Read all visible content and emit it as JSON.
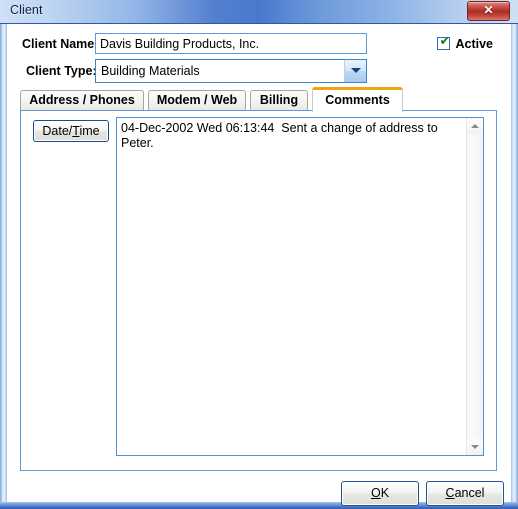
{
  "window": {
    "title": "Client",
    "close_label": "✕",
    "close_icon": "close-icon",
    "frame_color": "#3f6fc4",
    "titlebar_gradient_from": "#cfe0f5",
    "titlebar_gradient_to": "#4a78cd",
    "close_button_color": "#ab2c23"
  },
  "form": {
    "client_name": {
      "label": "Client Name:",
      "value": "Davis Building Products, Inc.",
      "placeholder": ""
    },
    "client_type": {
      "label": "Client Type:",
      "value": "Building Materials",
      "arrow_icon": "chevron-down-icon",
      "options": [
        "Building Materials"
      ]
    },
    "active": {
      "label": "Active",
      "checked": true,
      "check_glyph": "✔",
      "check_color": "#137d22"
    }
  },
  "tabs": {
    "selected_index": 3,
    "selected_color": "#f0a313",
    "items": [
      {
        "label": "Address / Phones"
      },
      {
        "label": "Modem / Web"
      },
      {
        "label": "Billing"
      },
      {
        "label": "Comments"
      }
    ]
  },
  "comments_page": {
    "datetime_button": {
      "label_before": "Date/",
      "label_accel": "T",
      "label_after": "ime"
    },
    "text": "04-Dec-2002 Wed 06:13:44  Sent a change of address to Peter.",
    "scrollbar": {
      "up_icon": "scroll-up-arrow-icon",
      "down_icon": "scroll-down-arrow-icon"
    }
  },
  "footer": {
    "ok": {
      "accel": "O",
      "after": "K"
    },
    "cancel": {
      "accel": "C",
      "after": "ancel"
    }
  }
}
